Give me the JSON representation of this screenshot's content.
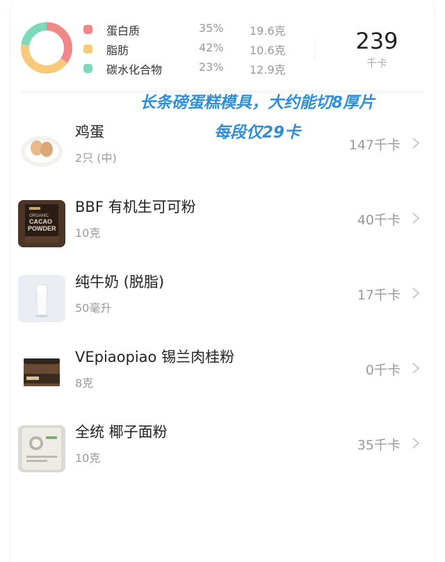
{
  "summary": {
    "macros": [
      {
        "name": "蛋白质",
        "percent": "35%",
        "amount": "19.6克",
        "percent_value": 35,
        "color": "#f0888a"
      },
      {
        "name": "脂肪",
        "percent": "42%",
        "amount": "10.6克",
        "percent_value": 42,
        "color": "#f7c97a"
      },
      {
        "name": "碳水化合物",
        "percent": "23%",
        "amount": "12.9克",
        "percent_value": 23,
        "color": "#7ed8bc"
      }
    ],
    "total_kcal": "239",
    "kcal_unit": "千卡"
  },
  "overlay_text": {
    "line1": "长条磅蛋糕模具，大约能切8厚片",
    "line2": "每段仅29卡"
  },
  "foods": [
    {
      "name": "鸡蛋",
      "quantity": "2只 (中)",
      "kcal": "147千卡",
      "icon": "egg-thumbnail"
    },
    {
      "name": "BBF 有机生可可粉",
      "quantity": "10克",
      "kcal": "40千卡",
      "icon": "cacao-powder-thumbnail",
      "package_text": "ORGANIC CACAO POWDER"
    },
    {
      "name": "纯牛奶 (脱脂)",
      "quantity": "50毫升",
      "kcal": "17千卡",
      "icon": "milk-glass-thumbnail"
    },
    {
      "name": "VEpiaopiao 锡兰肉桂粉",
      "quantity": "8克",
      "kcal": "0千卡",
      "icon": "cinnamon-jar-thumbnail"
    },
    {
      "name": "全统 椰子面粉",
      "quantity": "10克",
      "kcal": "35千卡",
      "icon": "coconut-flour-thumbnail"
    }
  ]
}
